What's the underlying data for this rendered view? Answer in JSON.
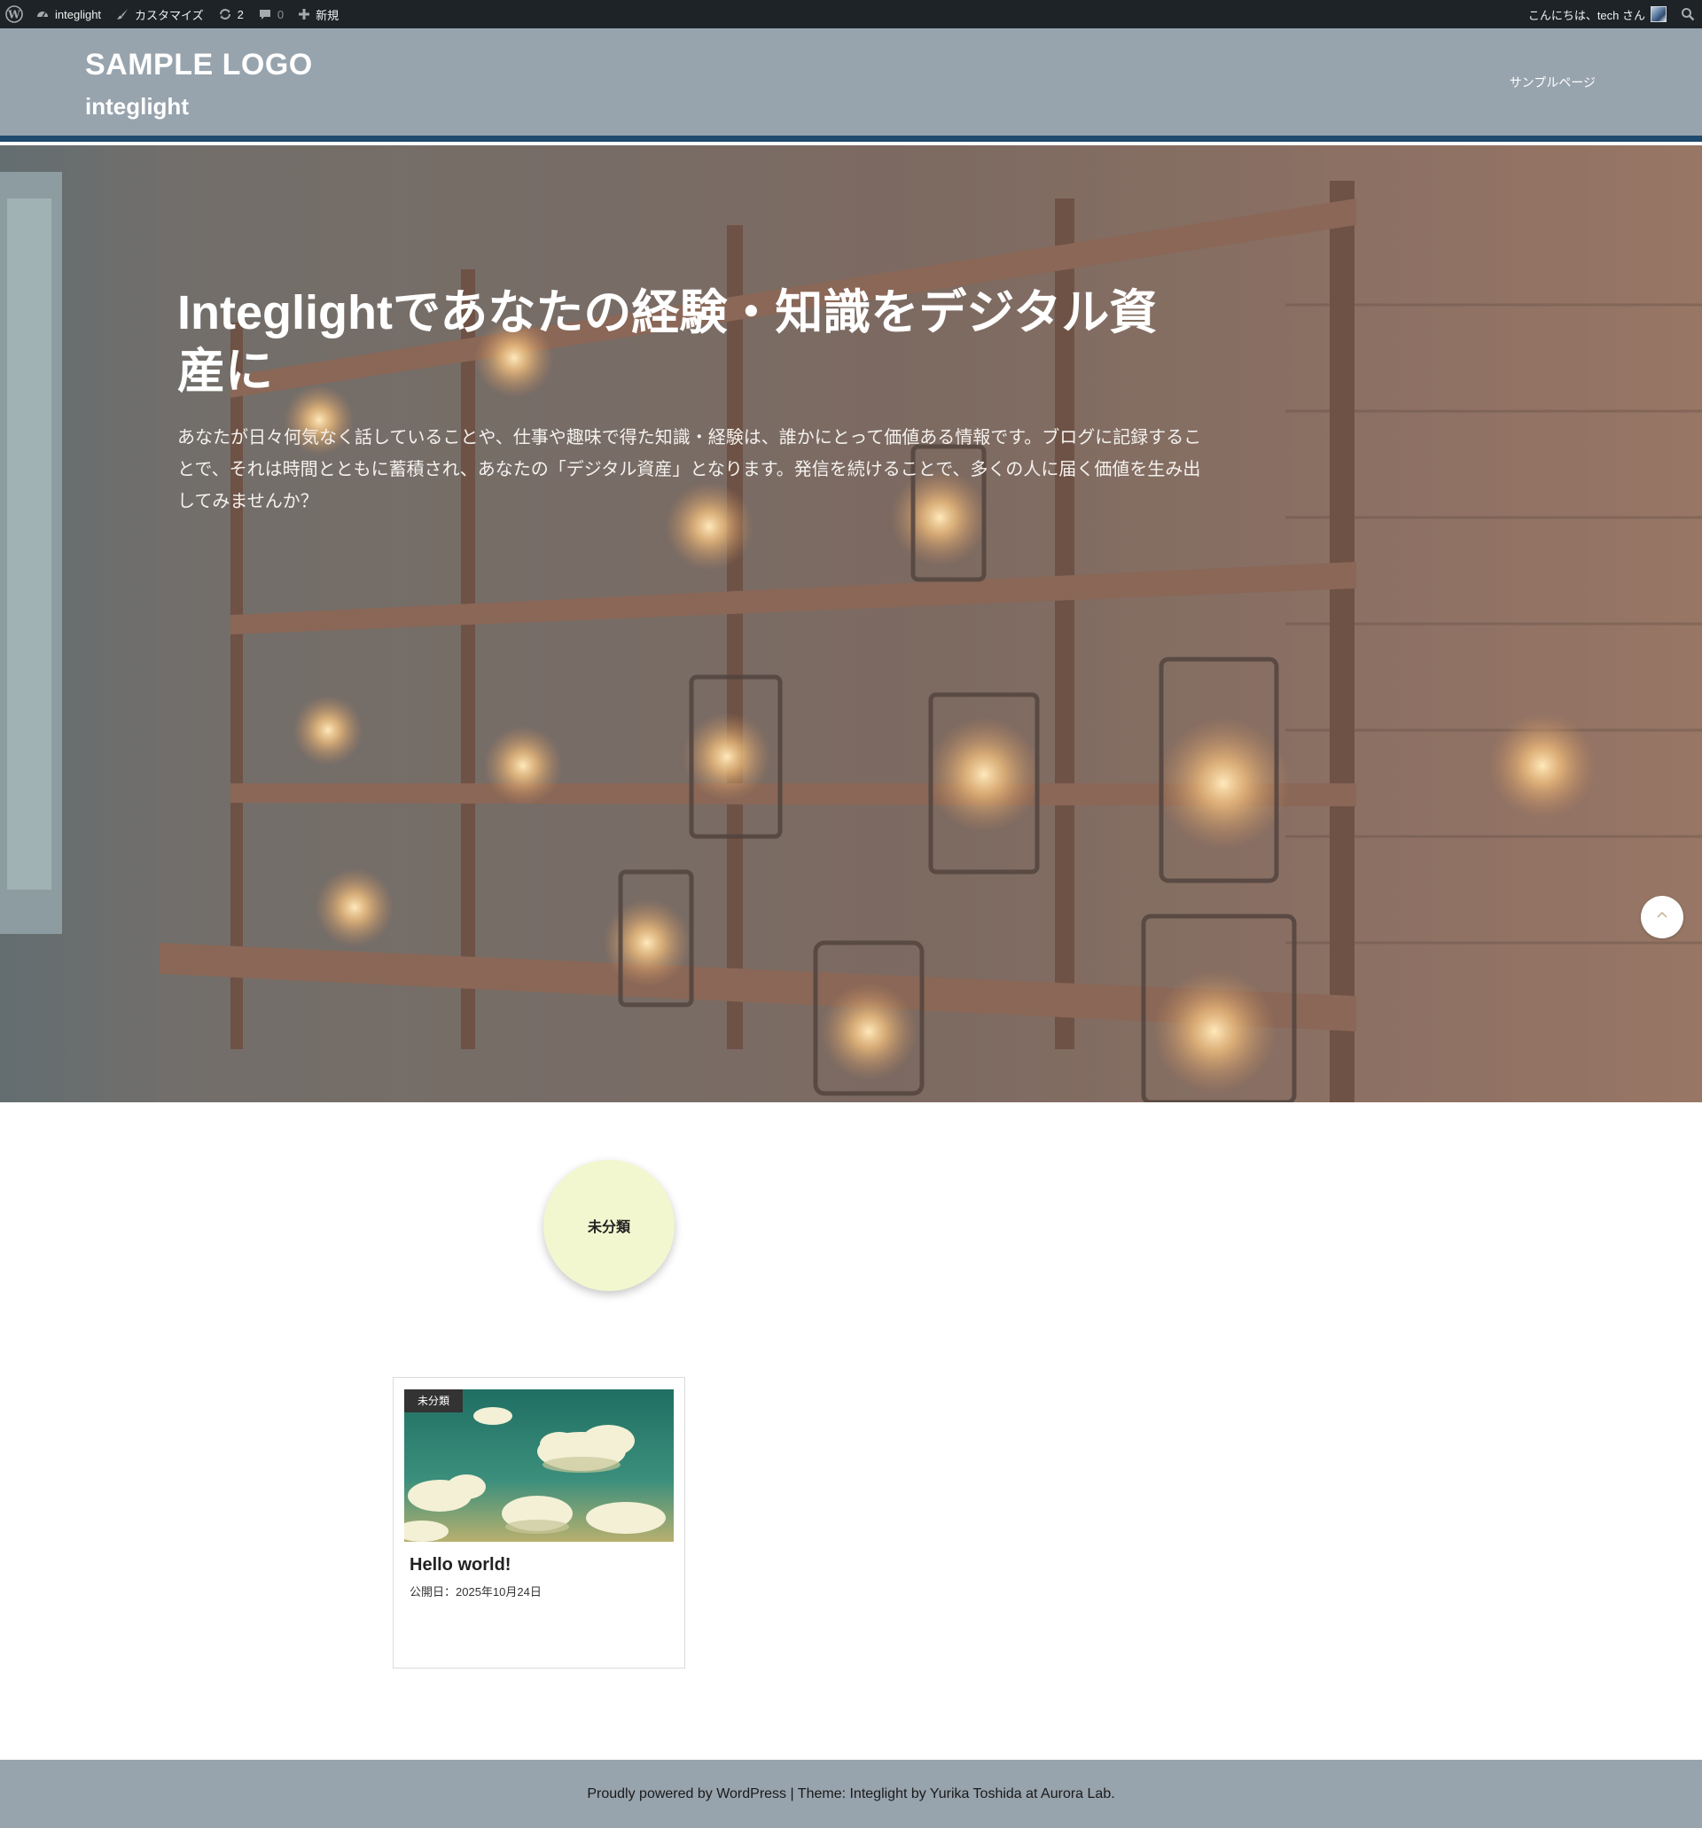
{
  "adminbar": {
    "site_label": "integlight",
    "customize_label": "カスタマイズ",
    "updates_count": "2",
    "comments_count": "0",
    "new_label": "新規",
    "greeting": "こんにちは、tech さん"
  },
  "header": {
    "logo": "SAMPLE LOGO",
    "site_name": "integlight",
    "nav_items": [
      "サンプルページ"
    ]
  },
  "hero": {
    "title": "Integlightであなたの経験・知識をデジタル資産に",
    "text": "あなたが日々何気なく話していることや、仕事や趣味で得た知識・経験は、誰かにとって価値ある情報です。ブログに記録することで、それは時間とともに蓄積され、あなたの「デジタル資産」となります。発信を続けることで、多くの人に届く価値を生み出してみませんか？"
  },
  "category_bubble": {
    "label": "未分類"
  },
  "post_card": {
    "category": "未分類",
    "title": "Hello world!",
    "date": "公開日：2025年10月24日"
  },
  "footer": {
    "text": "Proudly powered by WordPress | Theme: Integlight by Yurika Toshida at Aurora Lab."
  },
  "colors": {
    "adminbar_bg": "#1d2327",
    "header_bg": "#97a3ad",
    "header_stripe": "#1f4a6e",
    "category_bubble_bg": "#f3f7cf",
    "footer_bg": "#97a3ad"
  },
  "icons": [
    "wordpress-icon",
    "dashboard-icon",
    "brush-icon",
    "update-icon",
    "comment-icon",
    "plus-icon",
    "search-icon",
    "chevron-up-icon"
  ]
}
